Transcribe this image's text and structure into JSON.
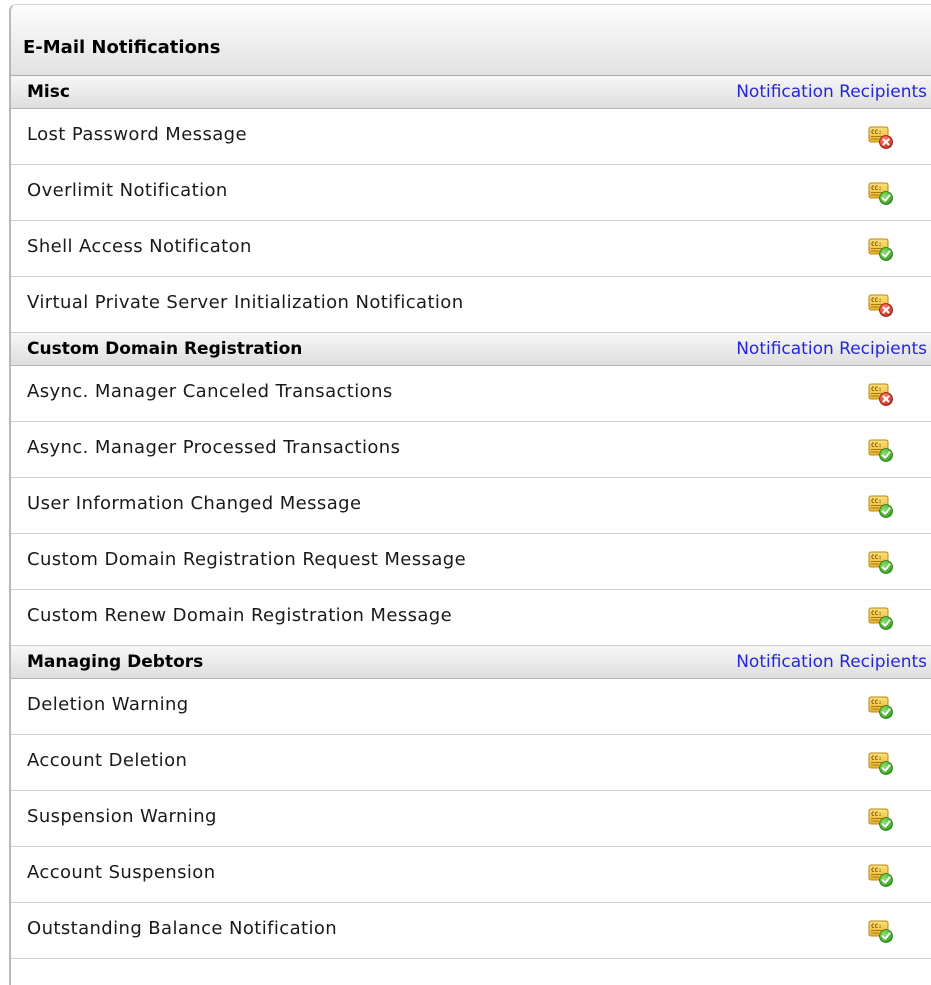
{
  "panel": {
    "title": "E-Mail Notifications"
  },
  "sections": [
    {
      "title": "Misc",
      "link_label": "Notification Recipients",
      "rows": [
        {
          "label": "Lost Password Message",
          "icon": "cc-disabled-icon"
        },
        {
          "label": "Overlimit Notification",
          "icon": "cc-enabled-icon"
        },
        {
          "label": "Shell Access Notificaton",
          "icon": "cc-enabled-icon"
        },
        {
          "label": "Virtual Private Server Initialization Notification",
          "icon": "cc-disabled-icon"
        }
      ]
    },
    {
      "title": "Custom Domain Registration",
      "link_label": "Notification Recipients",
      "rows": [
        {
          "label": "Async. Manager Canceled Transactions",
          "icon": "cc-disabled-icon"
        },
        {
          "label": "Async. Manager Processed Transactions",
          "icon": "cc-enabled-icon"
        },
        {
          "label": "User Information Changed Message",
          "icon": "cc-enabled-icon"
        },
        {
          "label": "Custom Domain Registration Request Message",
          "icon": "cc-enabled-icon"
        },
        {
          "label": "Custom Renew Domain Registration Message",
          "icon": "cc-enabled-icon"
        }
      ]
    },
    {
      "title": "Managing Debtors",
      "link_label": "Notification Recipients",
      "rows": [
        {
          "label": "Deletion Warning",
          "icon": "cc-enabled-icon"
        },
        {
          "label": "Account Deletion",
          "icon": "cc-enabled-icon"
        },
        {
          "label": "Suspension Warning",
          "icon": "cc-enabled-icon"
        },
        {
          "label": "Account Suspension",
          "icon": "cc-enabled-icon"
        },
        {
          "label": "Outstanding Balance Notification",
          "icon": "cc-enabled-icon"
        }
      ]
    }
  ],
  "icon_glyph": "CC:",
  "colors": {
    "link": "#2626d9",
    "card": "#f2c744",
    "enabled": "#3fae2a",
    "disabled": "#d93a2b"
  }
}
